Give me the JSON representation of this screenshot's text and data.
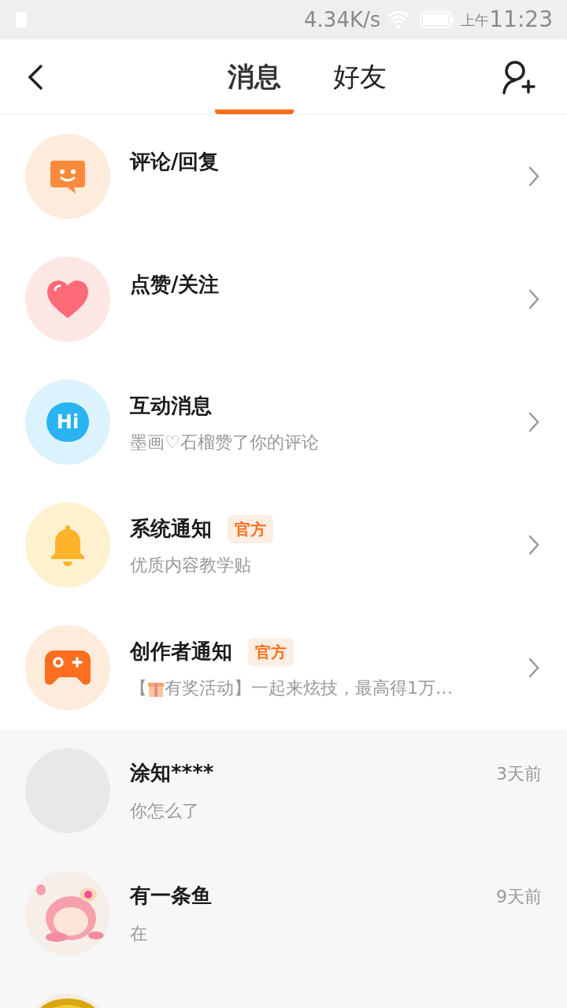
{
  "status_bar": {
    "speed": "4.34K/s",
    "period": "上午",
    "time": "11:23"
  },
  "header": {
    "tabs": [
      {
        "label": "消息",
        "selected": true
      },
      {
        "label": "好友",
        "selected": false
      }
    ]
  },
  "notifications": [
    {
      "kind": "comment",
      "title": "评论/回复"
    },
    {
      "kind": "heart",
      "title": "点赞/关注"
    },
    {
      "kind": "hi",
      "icon_text": "Hi",
      "title": "互动消息",
      "preview": [
        "墨画♡石榴赞了你的评论"
      ]
    },
    {
      "kind": "bell",
      "title": "系统通知",
      "badge": "官方",
      "preview": [
        "优质内容教学贴"
      ]
    },
    {
      "kind": "game",
      "title": "创作者通知",
      "badge": "官方",
      "preview": [
        "【",
        "有奖活动】一起来炫技，最高得1万…"
      ]
    }
  ],
  "chats": [
    {
      "kind": "blank",
      "name": "涂知****",
      "message": "你怎么了",
      "time": "3天前"
    },
    {
      "kind": "picture",
      "name": "有一条鱼",
      "message": "在",
      "time": "9天前"
    },
    {
      "kind": "partial"
    }
  ]
}
